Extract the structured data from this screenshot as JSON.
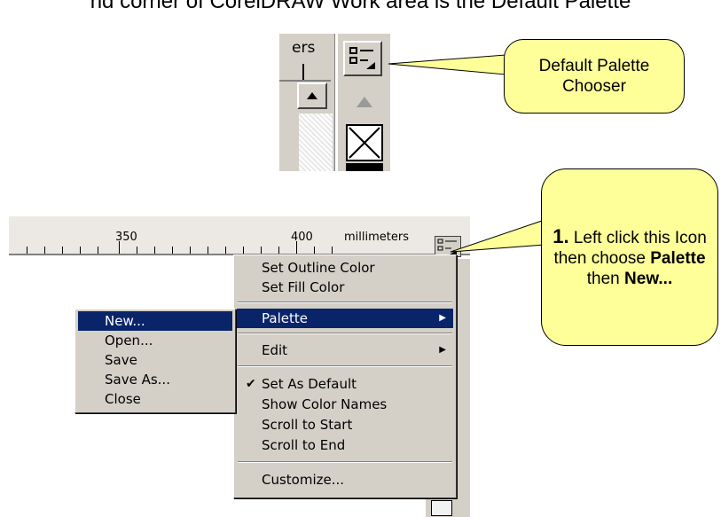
{
  "heading": "nd corner of CorelDRAW Work area is the Default Palette",
  "top_crop": {
    "tab_text": "ers"
  },
  "callout1": {
    "line1": "Default Palette",
    "line2": "Chooser"
  },
  "callout2": {
    "step": "1.",
    "text_a": " Left click this Icon then choose ",
    "bold_a": "Palette",
    "text_b": " then ",
    "bold_b": "New..."
  },
  "ruler": {
    "label_350": "350",
    "label_400": "400",
    "unit": "millimeters"
  },
  "main_menu": {
    "items": [
      {
        "label": "Set Outline Color"
      },
      {
        "label": "Set Fill Color"
      },
      {
        "label": "Palette"
      },
      {
        "label": "Edit"
      },
      {
        "label": "Set As Default",
        "checked": true
      },
      {
        "label": "Show Color Names"
      },
      {
        "label": "Scroll to Start"
      },
      {
        "label": "Scroll to End"
      },
      {
        "label": "Customize..."
      }
    ]
  },
  "sub_menu": {
    "items": [
      {
        "label": "New..."
      },
      {
        "label": "Open..."
      },
      {
        "label": "Save"
      },
      {
        "label": "Save As..."
      },
      {
        "label": "Close"
      }
    ]
  },
  "colors": {
    "menu_bg": "#d4d0c8",
    "highlight": "#0a246a",
    "callout": "#ffff99"
  },
  "icons": {
    "chooser": "palette-chooser-icon",
    "submenu": "submenu-arrow-icon",
    "check": "checkmark-icon"
  }
}
